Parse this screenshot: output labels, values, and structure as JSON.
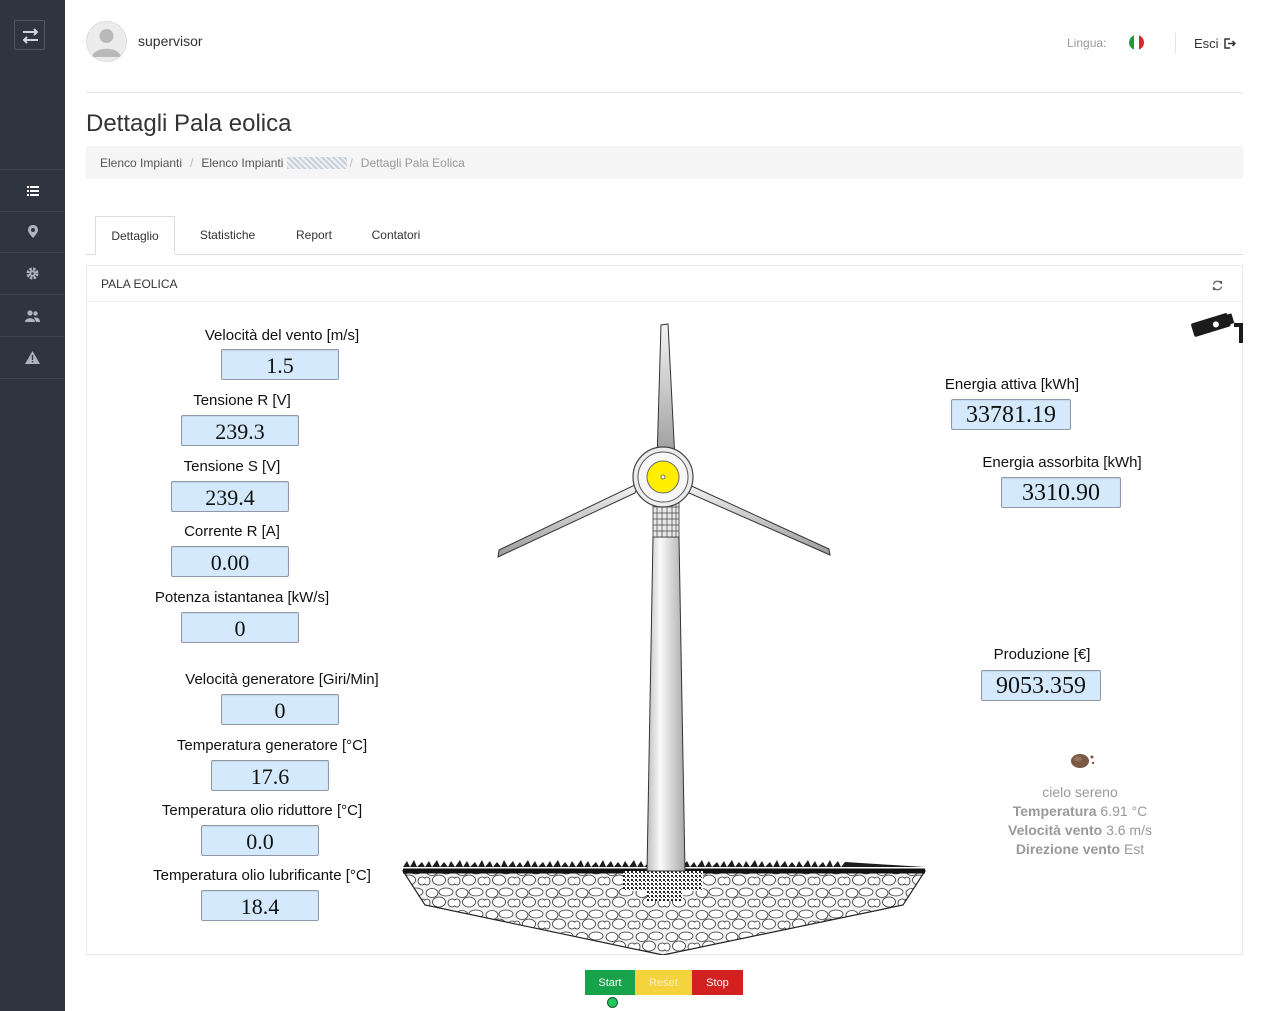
{
  "header": {
    "username": "supervisor",
    "language_label": "Lingua:",
    "logout_label": "Esci"
  },
  "page": {
    "title": "Dettagli Pala eolica"
  },
  "breadcrumb": {
    "items": [
      "Elenco Impianti",
      "Elenco Impianti",
      "Dettagli Pala Eolica"
    ]
  },
  "tabs": [
    "Dettaglio",
    "Statistiche",
    "Report",
    "Contatori"
  ],
  "panel": {
    "title": "PALA EOLICA"
  },
  "left_readings": [
    {
      "label": "Velocità del vento [m/s]",
      "value": "1.5"
    },
    {
      "label": "Tensione R [V]",
      "value": "239.3"
    },
    {
      "label": "Tensione S [V]",
      "value": "239.4"
    },
    {
      "label": "Corrente R [A]",
      "value": "0.00"
    },
    {
      "label": "Potenza istantanea [kW/s]",
      "value": "0"
    },
    {
      "label": "Velocità generatore [Giri/Min]",
      "value": "0"
    },
    {
      "label": "Temperatura generatore [°C]",
      "value": "17.6"
    },
    {
      "label": "Temperatura olio riduttore [°C]",
      "value": "0.0"
    },
    {
      "label": "Temperatura olio lubrificante [°C]",
      "value": "18.4"
    }
  ],
  "right_readings": [
    {
      "label": "Energia attiva [kWh]",
      "value": "33781.19"
    },
    {
      "label": "Energia assorbita [kWh]",
      "value": "3310.90"
    },
    {
      "label": "Produzione [€]",
      "value": "9053.359"
    }
  ],
  "weather": {
    "condition": "cielo sereno",
    "temperature_label": "Temperatura",
    "temperature_value": "6.91 °C",
    "wind_speed_label": "Velocità vento",
    "wind_speed_value": "3.6 m/s",
    "wind_dir_label": "Direzione vento",
    "wind_dir_value": "Est"
  },
  "controls": {
    "start_label": "Start",
    "reset_label": "Reset",
    "stop_label": "Stop",
    "status": "running"
  },
  "colors": {
    "sidebar_bg": "#2f3540",
    "value_bg": "#d4e9fb",
    "start": "#16a34a",
    "reset": "#f5d33c",
    "stop": "#d32020",
    "status_led": "#22c55e",
    "rotor_hub": "#ffee00"
  },
  "icons": {
    "sidebar_toggle": "swap-arrows-icon",
    "sidebar": [
      "list-icon",
      "map-marker-icon",
      "gear-icon",
      "users-icon",
      "warning-icon"
    ],
    "refresh": "refresh-icon",
    "camera": "security-camera-icon",
    "logout": "sign-out-icon",
    "weather": "weather-icon",
    "flag": "italian-flag-icon"
  }
}
